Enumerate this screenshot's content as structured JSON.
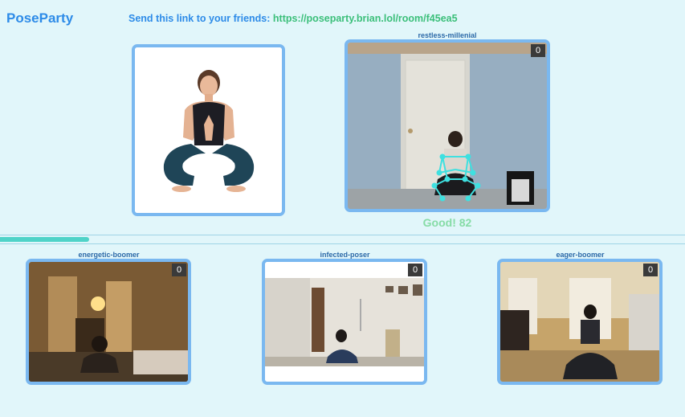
{
  "app": {
    "logo": "PoseParty"
  },
  "invite": {
    "prefix": "Send this link to your friends: ",
    "link": "https://poseparty.brian.lol/room/f45ea5"
  },
  "main_player": {
    "name": "restless-millenial",
    "score": "0",
    "feedback": "Good! 82"
  },
  "progress": {
    "fraction": 0.13
  },
  "players": [
    {
      "name": "energetic-boomer",
      "score": "0"
    },
    {
      "name": "infected-poser",
      "score": "0"
    },
    {
      "name": "eager-boomer",
      "score": "0"
    }
  ],
  "colors": {
    "accent": "#2d8be8",
    "link": "#3bbf7a",
    "tile_border": "#7ab8f0",
    "feedback": "#86dca6",
    "progress": "#4fd3c8",
    "skeleton": "#3fe0e0"
  },
  "icons": {
    "pose_reference": "pose-reference-image"
  }
}
